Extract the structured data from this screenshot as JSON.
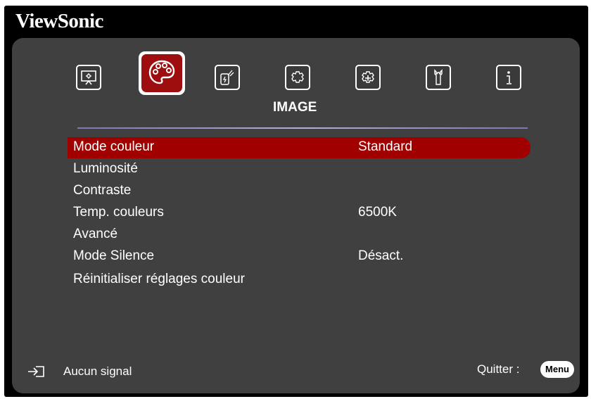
{
  "brand": "ViewSonic",
  "tabs": [
    {
      "icon": "display-icon",
      "selected": false
    },
    {
      "icon": "palette-icon",
      "selected": true
    },
    {
      "icon": "power-icon",
      "selected": false
    },
    {
      "icon": "gear-icon",
      "selected": false
    },
    {
      "icon": "advanced-gear-icon",
      "selected": false
    },
    {
      "icon": "wrench-icon",
      "selected": false
    },
    {
      "icon": "info-icon",
      "selected": false
    }
  ],
  "section_title": "IMAGE",
  "menu": [
    {
      "label": "Mode couleur",
      "value": "Standard"
    },
    {
      "label": "Luminosité",
      "value": ""
    },
    {
      "label": "Contraste",
      "value": ""
    },
    {
      "label": "Temp. couleurs",
      "value": "6500K"
    },
    {
      "label": "Avancé",
      "value": ""
    },
    {
      "label": "Mode Silence",
      "value": "Désact."
    },
    {
      "label": "Réinitialiser réglages couleur",
      "value": ""
    }
  ],
  "status": "Aucun signal",
  "quit_label": "Quitter :",
  "menu_key": "Menu",
  "colors": {
    "selected": "#a10000",
    "panel": "#404040",
    "frame": "#000000"
  }
}
